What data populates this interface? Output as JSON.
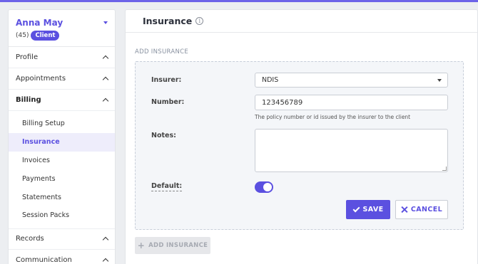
{
  "client": {
    "name": "Anna May",
    "count": "(45)",
    "badge": "Client"
  },
  "sidebar": {
    "groups": [
      {
        "label": "Profile"
      },
      {
        "label": "Appointments"
      },
      {
        "label": "Billing"
      },
      {
        "label": "Records"
      },
      {
        "label": "Communication"
      }
    ],
    "billing_items": [
      {
        "label": "Billing Setup"
      },
      {
        "label": "Insurance"
      },
      {
        "label": "Invoices"
      },
      {
        "label": "Payments"
      },
      {
        "label": "Statements"
      },
      {
        "label": "Session Packs"
      }
    ]
  },
  "main": {
    "title": "Insurance",
    "info_glyph": "i",
    "section_label": "ADD INSURANCE",
    "form": {
      "insurer_label": "Insurer:",
      "insurer_value": "NDIS",
      "number_label": "Number:",
      "number_value": "123456789",
      "number_hint": "The policy number or id issued by the insurer to the client",
      "notes_label": "Notes:",
      "notes_value": "",
      "default_label": "Default:",
      "default_on": true,
      "save_label": "SAVE",
      "cancel_label": "CANCEL"
    },
    "add_button_label": "ADD INSURANCE",
    "add_button_glyph": "+"
  },
  "colors": {
    "accent": "#5b50e0",
    "top_stripe": "#6c63e8"
  }
}
